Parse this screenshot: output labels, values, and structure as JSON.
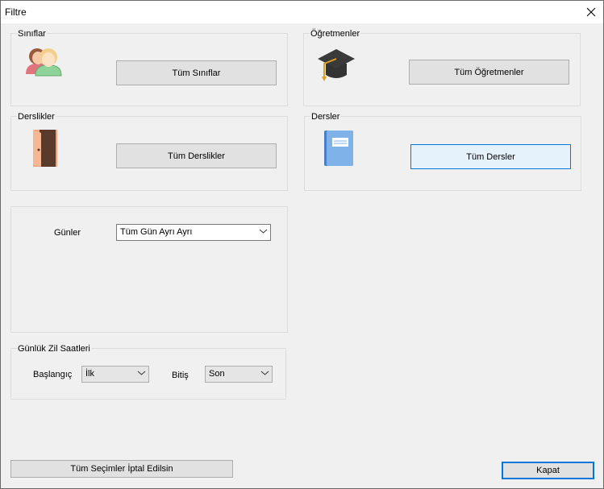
{
  "window": {
    "title": "Filtre"
  },
  "groups": {
    "siniflar": {
      "label": "Sınıflar",
      "button": "Tüm Sınıflar",
      "icon": "users-icon"
    },
    "ogretmenler": {
      "label": "Öğretmenler",
      "button": "Tüm Öğretmenler",
      "icon": "graduation-cap-icon"
    },
    "derslikler": {
      "label": "Derslikler",
      "button": "Tüm Derslikler",
      "icon": "door-icon"
    },
    "dersler": {
      "label": "Dersler",
      "button": "Tüm Dersler",
      "icon": "book-icon"
    }
  },
  "gunler": {
    "label": "Günler",
    "selected": "Tüm Gün Ayrı Ayrı"
  },
  "zil": {
    "label": "Günlük Zil Saatleri",
    "start_label": "Başlangıç",
    "start_value": "İlk",
    "end_label": "Bitiş",
    "end_value": "Son"
  },
  "footer": {
    "cancel_all": "Tüm Seçimler İptal Edilsin",
    "close": "Kapat"
  },
  "colors": {
    "accent": "#0078d7",
    "window_bg": "#f0f0f0",
    "button_bg": "#e1e1e1"
  }
}
